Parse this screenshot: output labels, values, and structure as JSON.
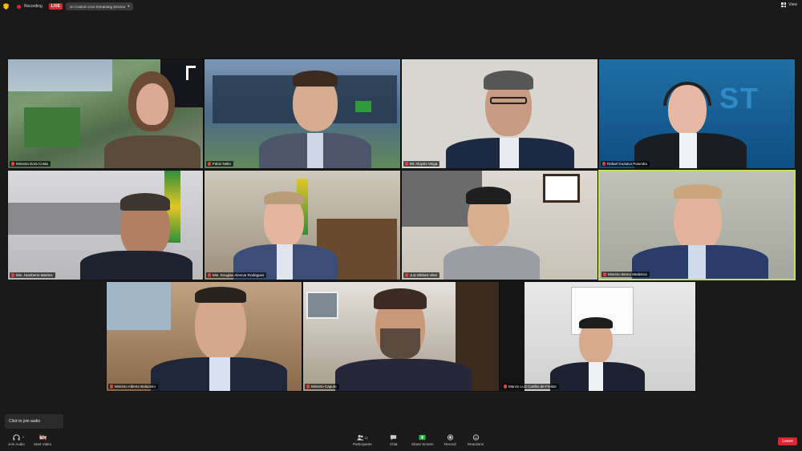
{
  "topbar": {
    "recording_label": "Recording",
    "live_label": "LIVE",
    "stream_label": "on Custom Live Streaming Service",
    "view_label": "View"
  },
  "participants": [
    {
      "name": "Ministra Dora Costa",
      "muted": true
    },
    {
      "name": "Fabio Nello",
      "muted": true
    },
    {
      "name": "Mr. Aloysio Veiga",
      "muted": true
    },
    {
      "name": "Rafael Gustavo Palumbo",
      "muted": true
    },
    {
      "name": "Min. Humberto Martins",
      "muted": true
    },
    {
      "name": "Min. Douglas Alencar Rodrigues",
      "muted": true
    },
    {
      "name": "Juiz Elkbert Vilen",
      "muted": true
    },
    {
      "name": "Ministro Breno Medeiros",
      "muted": true
    },
    {
      "name": "Ministro Alberto Balazeiro",
      "muted": true
    },
    {
      "name": "Ministro Caputo",
      "muted": true
    },
    {
      "name": "Marcio Luiz Coelho de Freitas",
      "muted": true
    }
  ],
  "tooltip": "Click to join audio",
  "toolbar": {
    "join_audio": "Join Audio",
    "start_video": "Start Video",
    "participants": "Participants",
    "participants_count": "21",
    "chat": "Chat",
    "share_screen": "Share Screen",
    "record": "Record",
    "reactions": "Reactions",
    "leave": "Leave"
  },
  "colors": {
    "active_speaker_border": "#c5e05a",
    "share_screen_green": "#2bb24c",
    "leave_red": "#d6282e"
  }
}
